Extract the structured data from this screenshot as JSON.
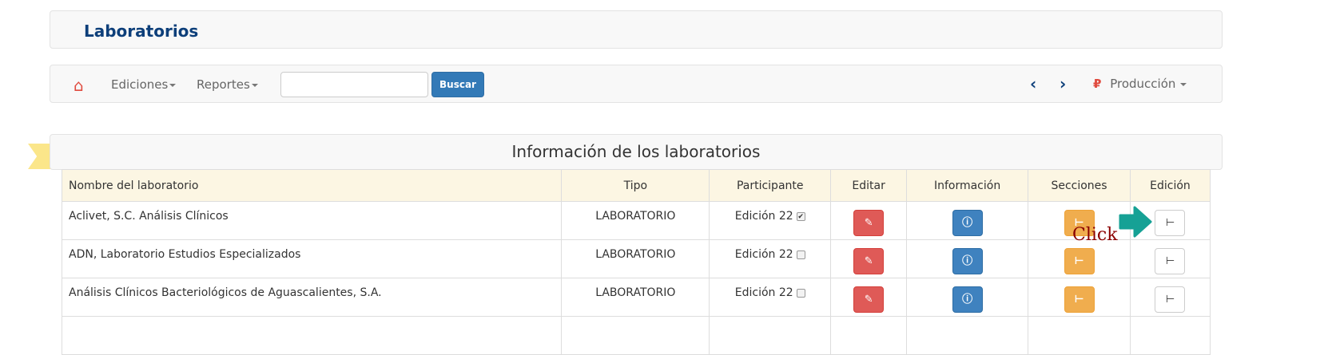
{
  "header": {
    "title": "Laboratorios"
  },
  "nav": {
    "home_icon": "home-icon",
    "items": [
      "Ediciones",
      "Reportes"
    ],
    "search_value": "",
    "search_button": "Buscar",
    "prev_icon": "chevron-left-icon",
    "next_icon": "chevron-right-icon",
    "env_icon": "ruble-icon",
    "env_label": "Producción"
  },
  "panel": {
    "title": "Información de los laboratorios"
  },
  "table": {
    "headers": [
      "Nombre del laboratorio",
      "Tipo",
      "Participante",
      "Editar",
      "Información",
      "Secciones",
      "Edición"
    ],
    "rows": [
      {
        "name": "Aclivet, S.C. Análisis Clínicos",
        "tipo": "LABORATORIO",
        "participante": "Edición 22",
        "checked": true
      },
      {
        "name": "ADN, Laboratorio Estudios Especializados",
        "tipo": "LABORATORIO",
        "participante": "Edición 22",
        "checked": false
      },
      {
        "name": "Análisis Clínicos Bacteriológicos de Aguascalientes, S.A.",
        "tipo": "LABORATORIO",
        "participante": "Edición 22",
        "checked": false
      }
    ]
  },
  "annotation": {
    "text": "Click",
    "color": "#8b0000",
    "arrow_color": "#16a195"
  },
  "colors": {
    "title": "#0d3f7a",
    "edit": "#df5a57",
    "info": "#3f82bf",
    "sections": "#f0ad4e",
    "primary": "#337ab7"
  }
}
